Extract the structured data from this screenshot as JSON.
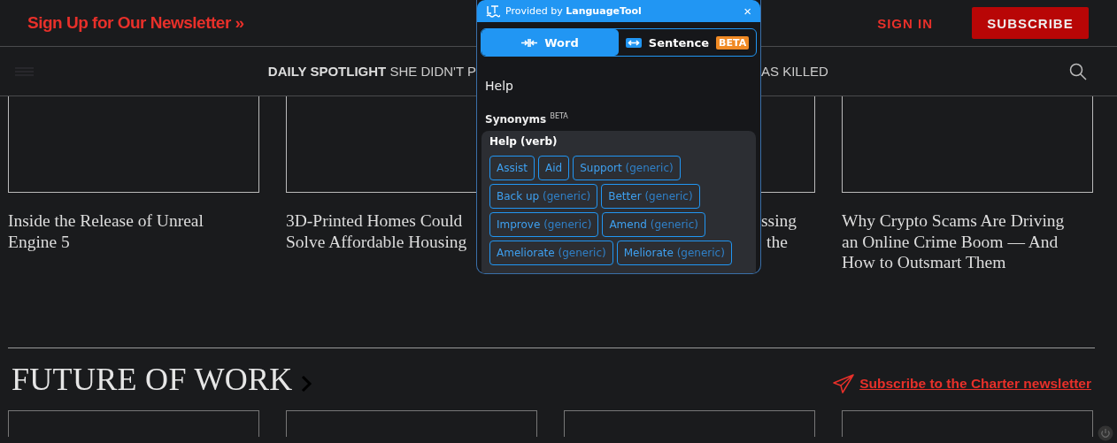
{
  "header": {
    "newsletter_link": "Sign Up for Our Newsletter",
    "newsletter_chevron": "»",
    "sign_in": "SIGN IN",
    "subscribe": "SUBSCRIBE"
  },
  "nav": {
    "spotlight_label": "DAILY SPOTLIGHT",
    "spotlight_before": "SHE DIDN'T P",
    "spotlight_after": "AS KILLED"
  },
  "articles": [
    {
      "title_lines": [
        "Inside the Release of Unreal",
        "Engine 5"
      ],
      "covered": false
    },
    {
      "title_lines": [
        "3D-Printed Homes Could",
        "Solve Affordable Housing"
      ],
      "covered": false
    },
    {
      "title_lines": [
        "ssing",
        "the"
      ],
      "covered": true
    },
    {
      "title_lines": [
        "Why Crypto Scams Are Driving",
        "an Online Crime Boom — And",
        "How to Outsmart Them"
      ],
      "covered": false
    }
  ],
  "section": {
    "title": "FUTURE OF WORK",
    "link": "Subscribe to the Charter newsletter"
  },
  "section_articles": [
    {
      "kind": "placeholder"
    },
    {
      "kind": "placeholder"
    },
    {
      "kind": "placeholder"
    },
    {
      "kind": "placeholder"
    }
  ],
  "popup": {
    "provider": "Provided by **LanguageTool**",
    "close": "×",
    "modes": [
      {
        "kind": "word",
        "label": "Word",
        "selected": true
      },
      {
        "kind": "sentence",
        "label": "Sentence",
        "badge": "BETA",
        "selected": false
      }
    ],
    "word": "Help",
    "synonyms_title": "Synonyms",
    "synonyms_badge": "BETA",
    "groups": [
      {
        "heading": "Help (verb)",
        "synonyms": [
          {
            "word": "Assist"
          },
          {
            "word": "Aid"
          },
          {
            "word": "Support",
            "note": "(generic)"
          },
          {
            "word": "Back up",
            "note": "(generic)"
          },
          {
            "word": "Better",
            "note": "(generic)"
          },
          {
            "word": "Improve",
            "note": "(generic)"
          },
          {
            "word": "Amend",
            "note": "(generic)"
          },
          {
            "word": "Ameliorate",
            "note": "(generic)"
          },
          {
            "word": "Meliorate",
            "note": "(generic)"
          }
        ]
      }
    ]
  }
}
